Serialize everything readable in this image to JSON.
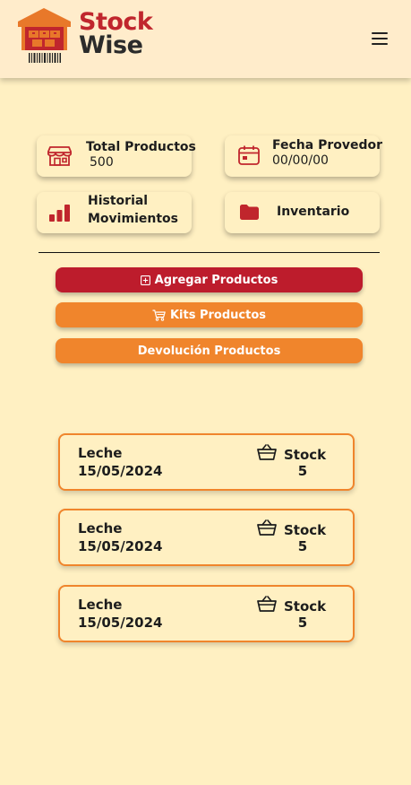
{
  "header": {
    "logo_line1": "Stock",
    "logo_line2": "Wise",
    "menu_icon": "hamburger-menu-icon"
  },
  "colors": {
    "background": "#fff0c2",
    "brand_red": "#bd1c2c",
    "brand_orange": "#f0852c"
  },
  "summary_cards": [
    {
      "icon": "store-icon",
      "label": "Total Productos",
      "value": "500"
    },
    {
      "icon": "calendar-icon",
      "label": "Fecha Provedor",
      "value": "00/00/00"
    },
    {
      "icon": "bar-chart-icon",
      "label": "Historial",
      "value": "Movimientos"
    },
    {
      "icon": "folder-icon",
      "label": "Inventario"
    }
  ],
  "actions": {
    "add_label": "Agregar Productos",
    "add_icon": "plus-square-icon",
    "kits_label": "Kits Productos",
    "kits_icon": "cart-icon",
    "return_label": "Devolución Productos"
  },
  "products": [
    {
      "name": "Leche",
      "date": "15/05/2024",
      "stock_label": "Stock",
      "stock": "5",
      "icon": "basket-icon"
    },
    {
      "name": "Leche",
      "date": "15/05/2024",
      "stock_label": "Stock",
      "stock": "5",
      "icon": "basket-icon"
    },
    {
      "name": "Leche",
      "date": "15/05/2024",
      "stock_label": "Stock",
      "stock": "5",
      "icon": "basket-icon"
    }
  ]
}
